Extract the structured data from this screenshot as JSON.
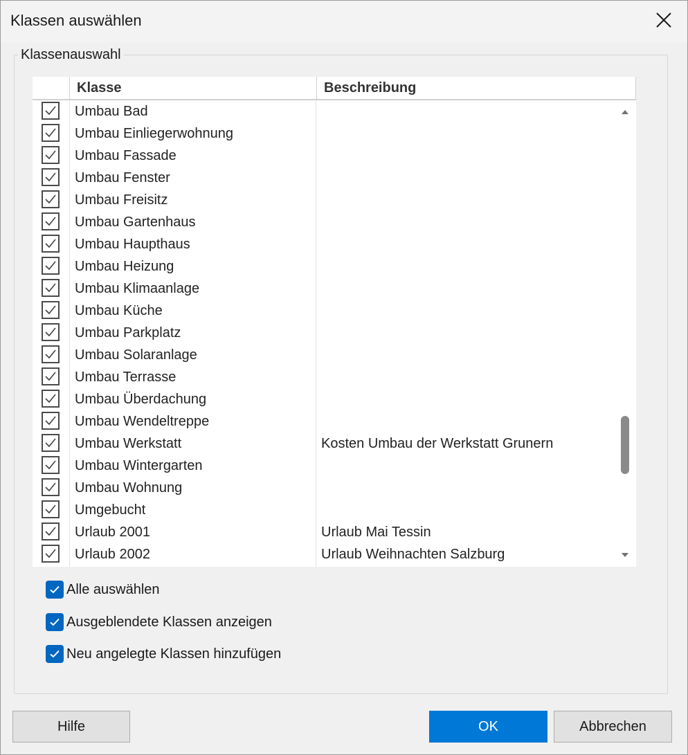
{
  "dialog": {
    "title": "Klassen auswählen",
    "group_label": "Klassenauswahl"
  },
  "table": {
    "columns": {
      "klasse": "Klasse",
      "beschreibung": "Beschreibung"
    },
    "rows": [
      {
        "klasse": "Umbau Bad",
        "beschreibung": "",
        "checked": true
      },
      {
        "klasse": "Umbau Einliegerwohnung",
        "beschreibung": "",
        "checked": true
      },
      {
        "klasse": "Umbau Fassade",
        "beschreibung": "",
        "checked": true
      },
      {
        "klasse": "Umbau Fenster",
        "beschreibung": "",
        "checked": true
      },
      {
        "klasse": "Umbau Freisitz",
        "beschreibung": "",
        "checked": true
      },
      {
        "klasse": "Umbau Gartenhaus",
        "beschreibung": "",
        "checked": true
      },
      {
        "klasse": "Umbau Haupthaus",
        "beschreibung": "",
        "checked": true
      },
      {
        "klasse": "Umbau Heizung",
        "beschreibung": "",
        "checked": true
      },
      {
        "klasse": "Umbau Klimaanlage",
        "beschreibung": "",
        "checked": true
      },
      {
        "klasse": "Umbau Küche",
        "beschreibung": "",
        "checked": true
      },
      {
        "klasse": "Umbau Parkplatz",
        "beschreibung": "",
        "checked": true
      },
      {
        "klasse": "Umbau Solaranlage",
        "beschreibung": "",
        "checked": true
      },
      {
        "klasse": "Umbau Terrasse",
        "beschreibung": "",
        "checked": true
      },
      {
        "klasse": "Umbau Überdachung",
        "beschreibung": "",
        "checked": true
      },
      {
        "klasse": "Umbau Wendeltreppe",
        "beschreibung": "",
        "checked": true
      },
      {
        "klasse": "Umbau Werkstatt",
        "beschreibung": "Kosten Umbau der Werkstatt Grunern",
        "checked": true
      },
      {
        "klasse": "Umbau Wintergarten",
        "beschreibung": "",
        "checked": true
      },
      {
        "klasse": "Umbau Wohnung",
        "beschreibung": "",
        "checked": true
      },
      {
        "klasse": "Umgebucht",
        "beschreibung": "",
        "checked": true
      },
      {
        "klasse": "Urlaub 2001",
        "beschreibung": "Urlaub Mai Tessin",
        "checked": true
      },
      {
        "klasse": "Urlaub 2002",
        "beschreibung": "Urlaub Weihnachten Salzburg",
        "checked": true
      }
    ]
  },
  "options": {
    "select_all": {
      "label": "Alle auswählen",
      "checked": true
    },
    "show_hidden": {
      "label": "Ausgeblendete Klassen anzeigen",
      "checked": true
    },
    "add_new": {
      "label": "Neu angelegte Klassen hinzufügen",
      "checked": true
    }
  },
  "buttons": {
    "help": "Hilfe",
    "ok": "OK",
    "cancel": "Abbrechen"
  },
  "colors": {
    "accent": "#0067c0",
    "ok_button": "#0078d7",
    "background": "#f0f0f0"
  }
}
